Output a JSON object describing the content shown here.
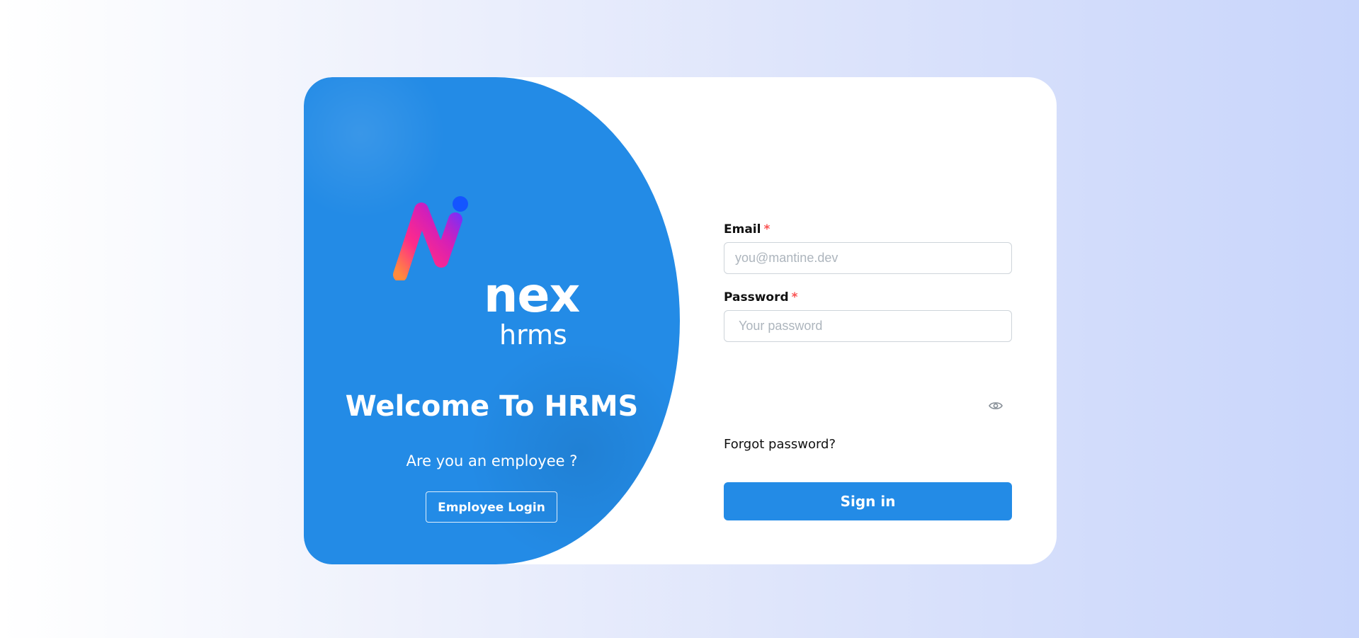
{
  "brand": {
    "logo_primary": "nex",
    "logo_secondary": "hrms",
    "accent_color": "#238be6"
  },
  "left": {
    "welcome_title": "Welcome To HRMS",
    "question": "Are you an employee ?",
    "employee_login_label": "Employee Login"
  },
  "form": {
    "email_label": "Email",
    "email_required": "*",
    "email_placeholder": "you@mantine.dev",
    "email_value": "",
    "password_label": "Password",
    "password_required": "*",
    "password_placeholder": "Your password",
    "password_value": "",
    "password_toggle_icon": "eye-icon",
    "forgot_label": "Forgot password?",
    "signin_label": "Sign in"
  }
}
